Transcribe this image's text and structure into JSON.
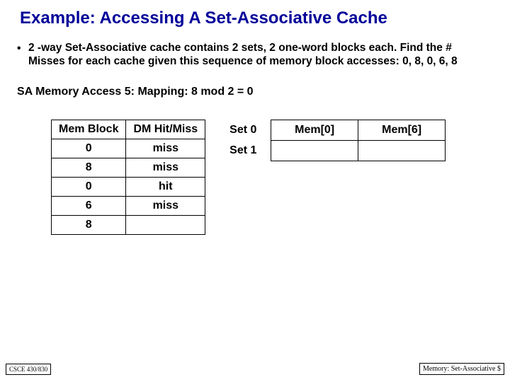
{
  "title": "Example: Accessing A Set-Associative Cache",
  "bullet": "2 -way Set-Associative cache contains 2 sets, 2 one-word blocks each. Find the # Misses for each cache given this sequence of memory block accesses: 0, 8, 0, 6, 8",
  "subhead": "SA Memory Access 5:  Mapping: 8 mod 2 = 0",
  "trace": {
    "h1": "Mem Block",
    "h2": "DM Hit/Miss",
    "rows": [
      {
        "blk": "0",
        "hm": "miss"
      },
      {
        "blk": "8",
        "hm": "miss"
      },
      {
        "blk": "0",
        "hm": "hit"
      },
      {
        "blk": "6",
        "hm": "miss"
      },
      {
        "blk": "8",
        "hm": ""
      }
    ]
  },
  "cache": {
    "rows": [
      {
        "label": "Set 0",
        "w0": "Mem[0]",
        "w1": "Mem[6]"
      },
      {
        "label": "Set 1",
        "w0": "",
        "w1": ""
      }
    ]
  },
  "footer_left": "CSCE 430/830",
  "footer_right": "Memory: Set-Associative $"
}
